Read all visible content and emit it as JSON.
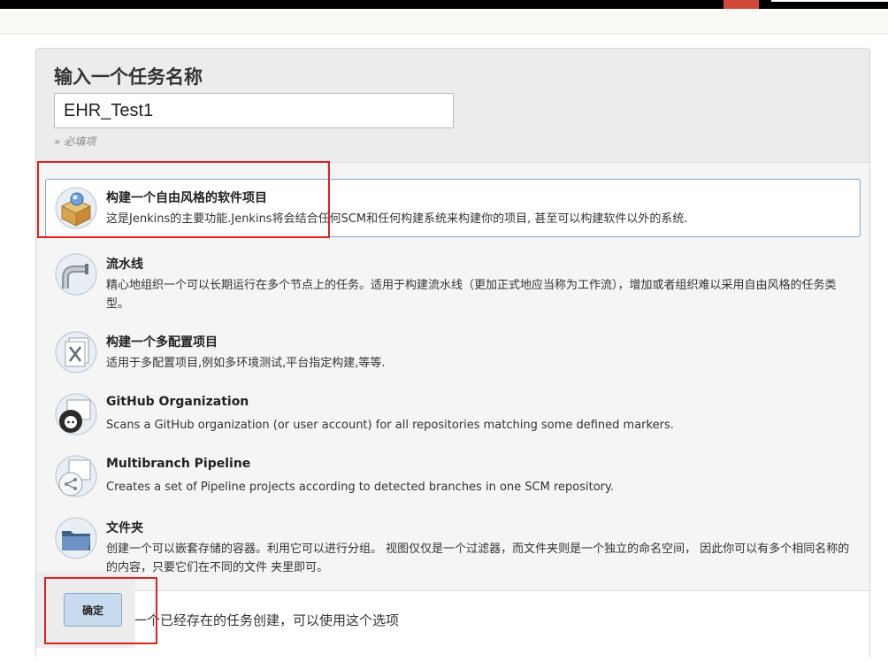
{
  "header": {
    "title": "输入一个任务名称"
  },
  "name_input": {
    "value": "EHR_Test1"
  },
  "required_hint": "» 必填项",
  "job_types": [
    {
      "title": "构建一个自由风格的软件项目",
      "description": "这是Jenkins的主要功能.Jenkins将会结合任何SCM和任何构建系统来构建你的项目, 甚至可以构建软件以外的系统.",
      "icon": "freestyle-box-icon",
      "selected": true
    },
    {
      "title": "流水线",
      "description": "精心地组织一个可以长期运行在多个节点上的任务。适用于构建流水线（更加正式地应当称为工作流），增加或者组织难以采用自由风格的任务类型。",
      "icon": "pipeline-pipe-icon",
      "selected": false
    },
    {
      "title": "构建一个多配置项目",
      "description": "适用于多配置项目,例如多环境测试,平台指定构建,等等.",
      "icon": "multi-config-icon",
      "selected": false
    },
    {
      "title": "GitHub Organization",
      "description": "Scans a GitHub organization (or user account) for all repositories matching some defined markers.",
      "icon": "github-octocat-icon",
      "selected": false
    },
    {
      "title": "Multibranch Pipeline",
      "description": "Creates a set of Pipeline projects according to detected branches in one SCM repository.",
      "icon": "multibranch-icon",
      "selected": false
    },
    {
      "title": "文件夹",
      "description": "创建一个可以嵌套存储的容器。利用它可以进行分组。 视图仅仅是一个过滤器，而文件夹则是一个独立的命名空间， 因此你可以有多个相同名称的的内容，只要它们在不同的文件 夹里即可。",
      "icon": "folder-icon",
      "selected": false
    }
  ],
  "copy_from": {
    "text": "如果你想根据一个已经存在的任务创建，可以使用这个选项"
  },
  "ok_button": {
    "label": "确定"
  },
  "colors": {
    "selected_border": "#7ea6c9",
    "annotation": "#e02020",
    "button_bg": "#c9dbef"
  }
}
